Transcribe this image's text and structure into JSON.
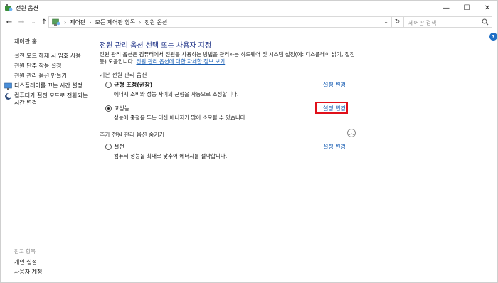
{
  "window": {
    "title": "전원 옵션",
    "minimize_glyph": "—",
    "maximize_glyph": "☐",
    "close_glyph": "✕"
  },
  "nav": {
    "back_glyph": "←",
    "forward_glyph": "→",
    "recent_glyph": "⌄",
    "up_glyph": "↑",
    "refresh_glyph": "↻"
  },
  "breadcrumb": [
    "제어판",
    "모든 제어판 항목",
    "전원 옵션"
  ],
  "search": {
    "placeholder": "제어판 검색"
  },
  "help_glyph": "?",
  "sidebar": {
    "home": "제어판 홈",
    "items": [
      {
        "label": "절전 모드 해제 시 암호 사용"
      },
      {
        "label": "전원 단추 작동 설정"
      },
      {
        "label": "전원 관리 옵션 만들기"
      },
      {
        "label": "디스플레이를 끄는 시간 설정",
        "icon": "display-icon"
      },
      {
        "label": "컴퓨터가 절전 모드로 전환되는 시간 변경",
        "icon": "moon-icon"
      }
    ],
    "see_also_title": "참고 항목",
    "see_also": [
      "개인 설정",
      "사용자 계정"
    ]
  },
  "main": {
    "heading": "전원 관리 옵션 선택 또는 사용자 지정",
    "description": "전원 관리 옵션은 컴퓨터에서 전원을 사용하는 방법을 관리하는 하드웨어 및 시스템 설정(예: 디스플레이 밝기, 절전 등) 모음입니다.",
    "description_link": "전원 관리 옵션에 대한 자세한 정보 보기",
    "section_basic": "기본 전원 관리 옵션",
    "section_more": "추가 전원 관리 옵션 숨기기",
    "collapse_glyph": "︿",
    "plans": [
      {
        "name": "균형 조정(권장)",
        "desc": "에너지 소비와 성능 사이의 균형을 자동으로 조정합니다.",
        "link": "설정 변경",
        "selected": false
      },
      {
        "name": "고성능",
        "desc": "성능에 중점을 두는 대신 에너지가 많이 소모될 수 있습니다.",
        "link": "설정 변경",
        "selected": true
      },
      {
        "name": "절전",
        "desc": "컴퓨터 성능을 최대로 낮추어 에너지를 절약합니다.",
        "link": "설정 변경",
        "selected": false
      }
    ]
  },
  "colors": {
    "heading": "#1e3287",
    "link": "#1a5fb4",
    "highlight": "#e0101a"
  }
}
